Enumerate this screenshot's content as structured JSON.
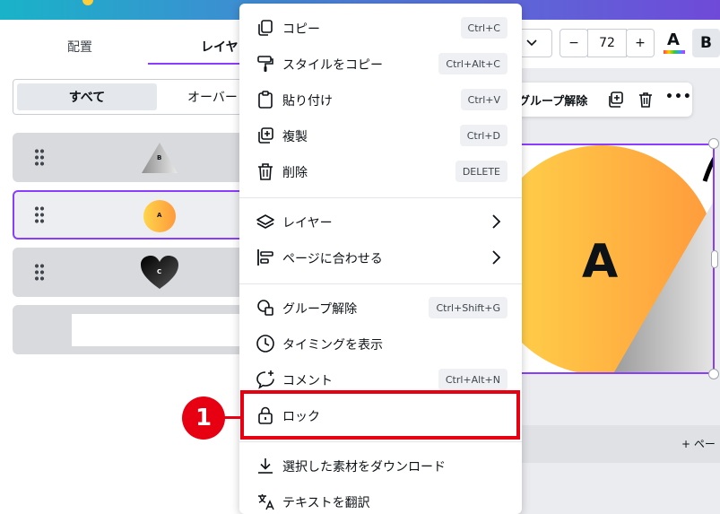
{
  "left_panel": {
    "tab_arrange": "配置",
    "tab_layer": "レイヤ",
    "filter_all": "すべて",
    "filter_overlay": "オーバー",
    "layers": [
      {
        "thumb_label": "B",
        "shape": "triangle"
      },
      {
        "thumb_label": "A",
        "shape": "circle"
      },
      {
        "thumb_label": "C",
        "shape": "heart"
      },
      {
        "thumb_label": "",
        "shape": "rectangle"
      }
    ]
  },
  "font_toolbar": {
    "decrease": "−",
    "size": "72",
    "increase": "+",
    "color_letter": "A",
    "bold": "B"
  },
  "context_toolbar": {
    "ungroup": "グループ解除",
    "more": "•••"
  },
  "canvas": {
    "letter": "A"
  },
  "page_strip": {
    "add_page": "+ ペー"
  },
  "menu": {
    "items": [
      {
        "label": "コピー",
        "shortcut": "Ctrl+C",
        "icon": "copy-icon"
      },
      {
        "label": "スタイルをコピー",
        "shortcut": "Ctrl+Alt+C",
        "icon": "paint-roller-icon"
      },
      {
        "label": "貼り付け",
        "shortcut": "Ctrl+V",
        "icon": "clipboard-icon"
      },
      {
        "label": "複製",
        "shortcut": "Ctrl+D",
        "icon": "duplicate-icon"
      },
      {
        "label": "削除",
        "shortcut": "DELETE",
        "icon": "trash-icon"
      },
      {
        "label": "レイヤー",
        "icon": "layers-icon"
      },
      {
        "label": "ページに合わせる",
        "icon": "align-icon"
      },
      {
        "label": "グループ解除",
        "shortcut": "Ctrl+Shift+G",
        "icon": "ungroup-icon"
      },
      {
        "label": "タイミングを表示",
        "icon": "clock-icon"
      },
      {
        "label": "コメント",
        "shortcut": "Ctrl+Alt+N",
        "icon": "comment-icon"
      },
      {
        "label": "ロック",
        "icon": "lock-icon"
      },
      {
        "label": "選択した素材をダウンロード",
        "icon": "download-icon"
      },
      {
        "label": "テキストを翻訳",
        "icon": "translate-icon"
      }
    ]
  },
  "callout": {
    "number": "1",
    "color": "#e60012"
  },
  "colors": {
    "accent": "#8b3dff"
  }
}
